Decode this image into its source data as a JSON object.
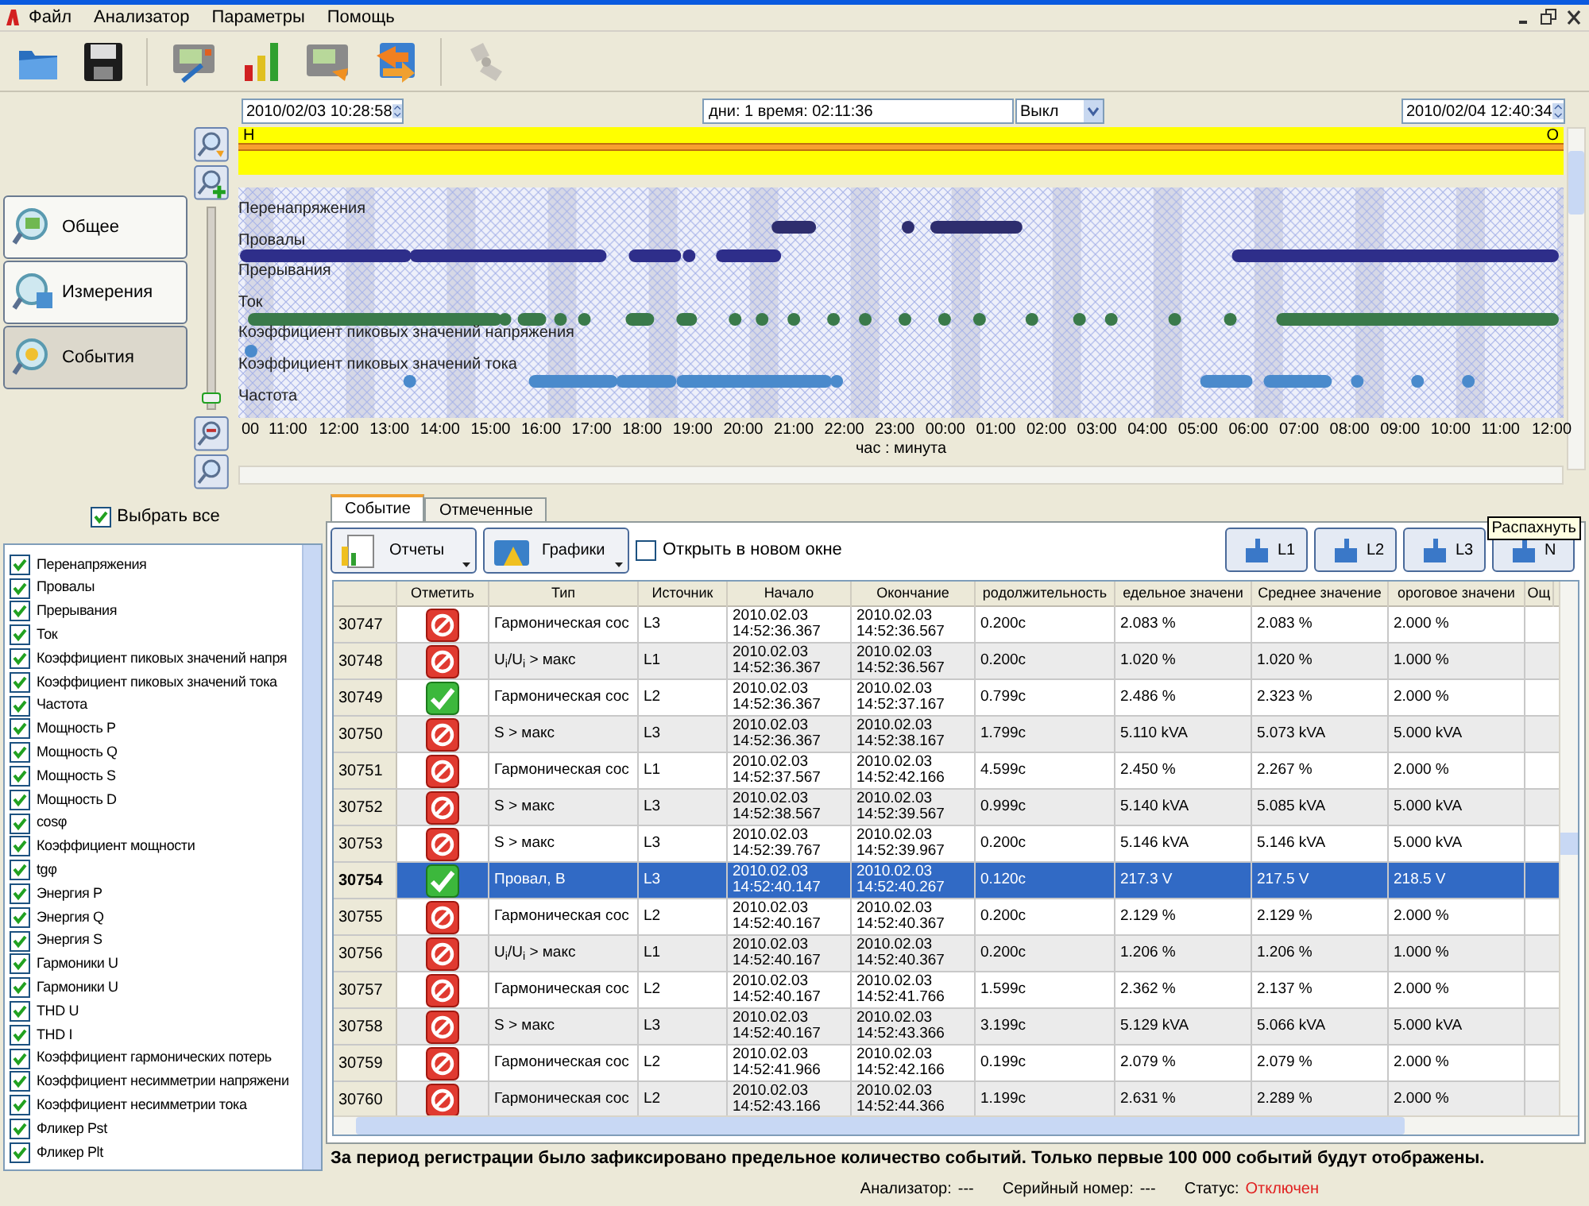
{
  "menu": [
    "Файл",
    "Анализатор",
    "Параметры",
    "Помощь"
  ],
  "timeline": {
    "start": "2010/02/03 10:28:58",
    "duration": "дни: 1 время: 02:11:36",
    "mode": "Выкл",
    "end": "2010/02/04 12:40:34",
    "start_marker": "Н",
    "end_marker": "О",
    "rows": [
      "Перенапряжения",
      "Провалы",
      "Прерывания",
      "Ток",
      "Коэффициент пиковых значений напряжения",
      "Коэффициент пиковых значений тока",
      "Частота"
    ],
    "ticks": [
      "00",
      "11:00",
      "12:00",
      "13:00",
      "14:00",
      "15:00",
      "16:00",
      "17:00",
      "18:00",
      "19:00",
      "20:00",
      "21:00",
      "22:00",
      "23:00",
      "00:00",
      "01:00",
      "02:00",
      "03:00",
      "04:00",
      "05:00",
      "06:00",
      "07:00",
      "08:00",
      "09:00",
      "10:00",
      "11:00",
      "12:00"
    ],
    "axis_label": "час : минута",
    "range": {
      "level": 1
    }
  },
  "zoom_slider": {
    "level": 0.03
  },
  "nav": [
    {
      "label": "Общее",
      "selected": false
    },
    {
      "label": "Измерения",
      "selected": false
    },
    {
      "label": "События",
      "selected": true
    }
  ],
  "select_all": {
    "label": "Выбрать все",
    "checked": true
  },
  "filters": [
    {
      "label": "Перенапряжения",
      "checked": true
    },
    {
      "label": "Провалы",
      "checked": true
    },
    {
      "label": "Прерывания",
      "checked": true
    },
    {
      "label": "Ток",
      "checked": true
    },
    {
      "label": "Коэффициент пиковых значений напря",
      "checked": true
    },
    {
      "label": "Коэффициент пиковых значений тока",
      "checked": true
    },
    {
      "label": "Частота",
      "checked": true
    },
    {
      "label": "Мощность P",
      "checked": true
    },
    {
      "label": "Мощность Q",
      "checked": true
    },
    {
      "label": "Мощность S",
      "checked": true
    },
    {
      "label": "Мощность D",
      "checked": true
    },
    {
      "label": "cosφ",
      "checked": true
    },
    {
      "label": "Коэффициент мощности",
      "checked": true
    },
    {
      "label": "tgφ",
      "checked": true
    },
    {
      "label": "Энергия P",
      "checked": true
    },
    {
      "label": "Энергия Q",
      "checked": true
    },
    {
      "label": "Энергия S",
      "checked": true
    },
    {
      "label": "Гармоники U",
      "checked": true
    },
    {
      "label": "Гармоники U",
      "checked": true
    },
    {
      "label": "THD U",
      "checked": true
    },
    {
      "label": "THD I",
      "checked": true
    },
    {
      "label": "Коэффициент гармонических потерь",
      "checked": true
    },
    {
      "label": "Коэффициент несимметрии напряжени",
      "checked": true
    },
    {
      "label": "Коэффициент несимметрии тока",
      "checked": true
    },
    {
      "label": "Фликер Pst",
      "checked": true
    },
    {
      "label": "Фликер Plt",
      "checked": true
    }
  ],
  "tabs": [
    {
      "label": "Событие",
      "selected": true
    },
    {
      "label": "Отмеченные",
      "selected": false
    }
  ],
  "actions": [
    "Отчеты",
    "Графики"
  ],
  "open_new_window": {
    "label": "Открыть в новом окне",
    "checked": false
  },
  "phase_buttons": [
    "L1",
    "L2",
    "L3",
    "N"
  ],
  "tooltip": "Распахнуть",
  "table": {
    "columns": [
      "",
      "Отметить",
      "Тип",
      "Источник",
      "Начало",
      "Окончание",
      "родолжительность",
      "едельное значени",
      "Среднее значение",
      "ороговое значени",
      "Ощ"
    ],
    "rows": [
      {
        "id": "30747",
        "marked": false,
        "selected": false,
        "type": "Гармоническая сос",
        "source": "L3",
        "start": [
          "2010.02.03",
          "14:52:36.367"
        ],
        "end": [
          "2010.02.03",
          "14:52:36.567"
        ],
        "duration": "0.200с",
        "limit": "2.083 %",
        "mean": "2.083 %",
        "threshold": "2.000 %"
      },
      {
        "id": "30748",
        "marked": false,
        "selected": false,
        "type": "U$_{i}$/U$_{i}$ > макс",
        "source": "L1",
        "start": [
          "2010.02.03",
          "14:52:36.367"
        ],
        "end": [
          "2010.02.03",
          "14:52:36.567"
        ],
        "duration": "0.200с",
        "limit": "1.020 %",
        "mean": "1.020 %",
        "threshold": "1.000 %"
      },
      {
        "id": "30749",
        "marked": true,
        "selected": false,
        "type": "Гармоническая сос",
        "source": "L2",
        "start": [
          "2010.02.03",
          "14:52:36.367"
        ],
        "end": [
          "2010.02.03",
          "14:52:37.167"
        ],
        "duration": "0.799с",
        "limit": "2.486 %",
        "mean": "2.323 %",
        "threshold": "2.000 %"
      },
      {
        "id": "30750",
        "marked": false,
        "selected": false,
        "type": "S > макс",
        "source": "L3",
        "start": [
          "2010.02.03",
          "14:52:36.367"
        ],
        "end": [
          "2010.02.03",
          "14:52:38.167"
        ],
        "duration": "1.799с",
        "limit": "5.110 kVA",
        "mean": "5.073 kVA",
        "threshold": "5.000 kVA"
      },
      {
        "id": "30751",
        "marked": false,
        "selected": false,
        "type": "Гармоническая сос",
        "source": "L1",
        "start": [
          "2010.02.03",
          "14:52:37.567"
        ],
        "end": [
          "2010.02.03",
          "14:52:42.166"
        ],
        "duration": "4.599с",
        "limit": "2.450 %",
        "mean": "2.267 %",
        "threshold": "2.000 %"
      },
      {
        "id": "30752",
        "marked": false,
        "selected": false,
        "type": "S > макс",
        "source": "L3",
        "start": [
          "2010.02.03",
          "14:52:38.567"
        ],
        "end": [
          "2010.02.03",
          "14:52:39.567"
        ],
        "duration": "0.999с",
        "limit": "5.140 kVA",
        "mean": "5.085 kVA",
        "threshold": "5.000 kVA"
      },
      {
        "id": "30753",
        "marked": false,
        "selected": false,
        "type": "S > макс",
        "source": "L3",
        "start": [
          "2010.02.03",
          "14:52:39.767"
        ],
        "end": [
          "2010.02.03",
          "14:52:39.967"
        ],
        "duration": "0.200с",
        "limit": "5.146 kVA",
        "mean": "5.146 kVA",
        "threshold": "5.000 kVA"
      },
      {
        "id": "30754",
        "marked": true,
        "selected": true,
        "type": "Провал, В",
        "source": "L3",
        "start": [
          "2010.02.03",
          "14:52:40.147"
        ],
        "end": [
          "2010.02.03",
          "14:52:40.267"
        ],
        "duration": "0.120с",
        "limit": "217.3 V",
        "mean": "217.5 V",
        "threshold": "218.5 V"
      },
      {
        "id": "30755",
        "marked": false,
        "selected": false,
        "type": "Гармоническая сос",
        "source": "L2",
        "start": [
          "2010.02.03",
          "14:52:40.167"
        ],
        "end": [
          "2010.02.03",
          "14:52:40.367"
        ],
        "duration": "0.200с",
        "limit": "2.129 %",
        "mean": "2.129 %",
        "threshold": "2.000 %"
      },
      {
        "id": "30756",
        "marked": false,
        "selected": false,
        "type": "U$_{i}$/U$_{i}$ > макс",
        "source": "L1",
        "start": [
          "2010.02.03",
          "14:52:40.167"
        ],
        "end": [
          "2010.02.03",
          "14:52:40.367"
        ],
        "duration": "0.200с",
        "limit": "1.206 %",
        "mean": "1.206 %",
        "threshold": "1.000 %"
      },
      {
        "id": "30757",
        "marked": false,
        "selected": false,
        "type": "Гармоническая сос",
        "source": "L2",
        "start": [
          "2010.02.03",
          "14:52:40.167"
        ],
        "end": [
          "2010.02.03",
          "14:52:41.766"
        ],
        "duration": "1.599с",
        "limit": "2.362 %",
        "mean": "2.137 %",
        "threshold": "2.000 %"
      },
      {
        "id": "30758",
        "marked": false,
        "selected": false,
        "type": "S > макс",
        "source": "L3",
        "start": [
          "2010.02.03",
          "14:52:40.167"
        ],
        "end": [
          "2010.02.03",
          "14:52:43.366"
        ],
        "duration": "3.199с",
        "limit": "5.129 kVA",
        "mean": "5.066 kVA",
        "threshold": "5.000 kVA"
      },
      {
        "id": "30759",
        "marked": false,
        "selected": false,
        "type": "Гармоническая сос",
        "source": "L2",
        "start": [
          "2010.02.03",
          "14:52:41.966"
        ],
        "end": [
          "2010.02.03",
          "14:52:42.166"
        ],
        "duration": "0.199с",
        "limit": "2.079 %",
        "mean": "2.079 %",
        "threshold": "2.000 %"
      },
      {
        "id": "30760",
        "marked": false,
        "selected": false,
        "type": "Гармоническая сос",
        "source": "L2",
        "start": [
          "2010.02.03",
          "14:52:43.166"
        ],
        "end": [
          "2010.02.03",
          "14:52:44.366"
        ],
        "duration": "1.199с",
        "limit": "2.631 %",
        "mean": "2.289 %",
        "threshold": "2.000 %"
      }
    ]
  },
  "message": "За период регистрации было зафиксировано предельное количество событий. Только первые 100 000 событий будут отображены.",
  "status_bar": [
    {
      "label": "Анализатор:",
      "value": "---",
      "alert": false
    },
    {
      "label": "Серийный номер:",
      "value": "---",
      "alert": false
    },
    {
      "label": "Статус:",
      "value": "Отключен",
      "alert": true
    }
  ]
}
